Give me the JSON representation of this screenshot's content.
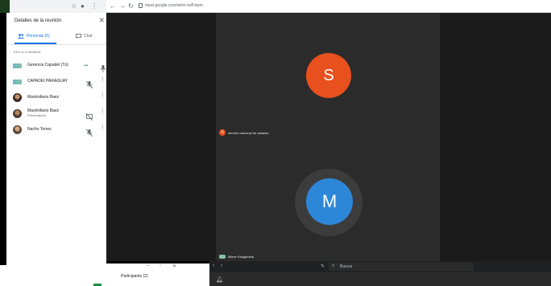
{
  "browser": {
    "url": "meet.google.com/wmn-ovff-kwm",
    "icons": [
      "star-icon",
      "account-icon",
      "menu-icon",
      "back-icon",
      "forward-icon",
      "reload-icon",
      "lock-icon"
    ]
  },
  "panel": {
    "title": "Detalles de la reunión",
    "tabs": [
      {
        "label": "Personas (5)",
        "active": true
      },
      {
        "label": "Chat",
        "active": false
      }
    ],
    "section_label": "EN LA LLAMADA",
    "participants": [
      {
        "name": "Gerencia Capadel (Tú)",
        "sub": "",
        "avatar": "logo",
        "speaking": true,
        "mic_muted": false,
        "has_more": false
      },
      {
        "name": "CAPADEI PARAGUAY",
        "sub": "",
        "avatar": "logo",
        "speaking": false,
        "mic_muted": true,
        "has_more": true
      },
      {
        "name": "Maximiliano Baez",
        "sub": "",
        "avatar": "photo1",
        "speaking": false,
        "mic_muted": false,
        "has_more": true
      },
      {
        "name": "Maximiliano Baez",
        "sub": "Presentación",
        "avatar": "photo2",
        "speaking": false,
        "mic_muted": true,
        "has_more": true
      },
      {
        "name": "Nacho Torres",
        "sub": "",
        "avatar": "photo3",
        "speaking": false,
        "mic_muted": true,
        "has_more": true
      }
    ]
  },
  "meeting": {
    "tile1": {
      "initial": "S",
      "label": "servicio nacional de catastro",
      "color": "#e8501e"
    },
    "tile2": {
      "initial": "M",
      "label": "Milner Estigarribia",
      "color": "#2d87d9"
    }
  },
  "taskbar": {
    "search_placeholder": "Buscar"
  },
  "mini_window": {
    "title": "Participants (2)"
  }
}
